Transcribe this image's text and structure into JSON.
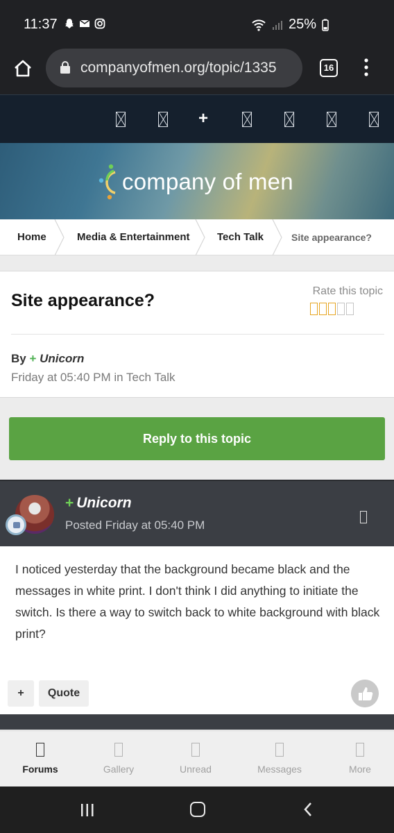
{
  "status_bar": {
    "time": "11:37",
    "battery": "25%"
  },
  "browser": {
    "url": "companyofmen.org/topic/1335",
    "tab_count": "16"
  },
  "site": {
    "logo_text": "company of men"
  },
  "breadcrumb": [
    "Home",
    "Media & Entertainment",
    "Tech Talk",
    "Site appearance?"
  ],
  "topic": {
    "title": "Site appearance?",
    "rate_label": "Rate this topic",
    "rating": 3,
    "rating_max": 5,
    "by_label": "By",
    "author": "Unicorn",
    "meta": "Friday at 05:40 PM in Tech Talk"
  },
  "reply_label": "Reply to this topic",
  "post": {
    "author": "Unicorn",
    "posted": "Posted Friday at 05:40 PM",
    "body": "I noticed yesterday that the background became black and the messages in white print. I don't think I did anything to initiate the switch. Is there a way to switch back to white background with black print?",
    "plus_label": "+",
    "quote_label": "Quote"
  },
  "tabs": [
    {
      "label": "Forums",
      "active": true
    },
    {
      "label": "Gallery",
      "active": false
    },
    {
      "label": "Unread",
      "active": false
    },
    {
      "label": "Messages",
      "active": false
    },
    {
      "label": "More",
      "active": false
    }
  ],
  "colors": {
    "accent_green": "#5aa343",
    "nav_dark": "#15202d",
    "post_header": "#3b3e44",
    "star": "#e6a41f"
  }
}
